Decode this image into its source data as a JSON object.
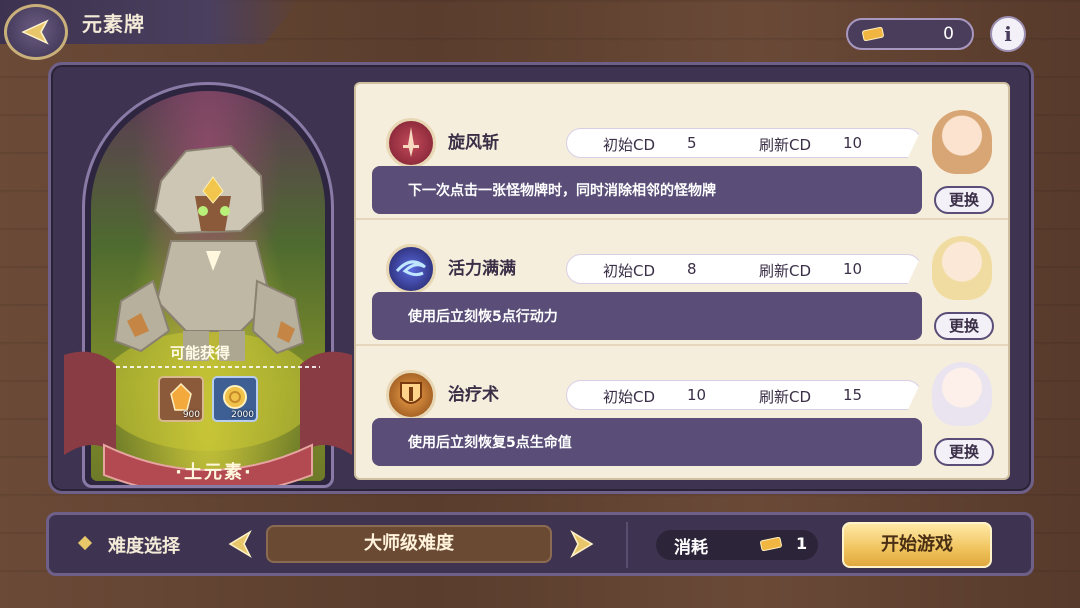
{
  "header": {
    "title": "元素牌",
    "currency_value": "0"
  },
  "element_card": {
    "name": "·土元素·",
    "reward_heading": "可能获得",
    "rewards": [
      {
        "icon": "amber-crystal-icon",
        "quantity": "900"
      },
      {
        "icon": "gold-coin-icon",
        "quantity": "2000"
      }
    ]
  },
  "skills": [
    {
      "name": "旋风斩",
      "icon": "sword-icon",
      "initial_cd_label": "初始CD",
      "initial_cd": "5",
      "refresh_cd_label": "刷新CD",
      "refresh_cd": "10",
      "description": "下一次点击一张怪物牌时，同时消除相邻的怪物牌",
      "swap_label": "更换"
    },
    {
      "name": "活力满满",
      "icon": "vortex-icon",
      "initial_cd_label": "初始CD",
      "initial_cd": "8",
      "refresh_cd_label": "刷新CD",
      "refresh_cd": "10",
      "description": "使用后立刻恢5点行动力",
      "swap_label": "更换"
    },
    {
      "name": "治疗术",
      "icon": "shield-icon",
      "initial_cd_label": "初始CD",
      "initial_cd": "10",
      "refresh_cd_label": "刷新CD",
      "refresh_cd": "15",
      "description": "使用后立刻恢复5点生命值",
      "swap_label": "更换"
    }
  ],
  "footer": {
    "difficulty_label": "难度选择",
    "difficulty_value": "大师级难度",
    "cost_label": "消耗",
    "cost_value": "1",
    "start_label": "开始游戏"
  },
  "colors": {
    "panel": "#3e3451",
    "accent_gold": "#e8c66a",
    "desc_bar": "#5a4e78",
    "parchment": "#f6eedc"
  }
}
